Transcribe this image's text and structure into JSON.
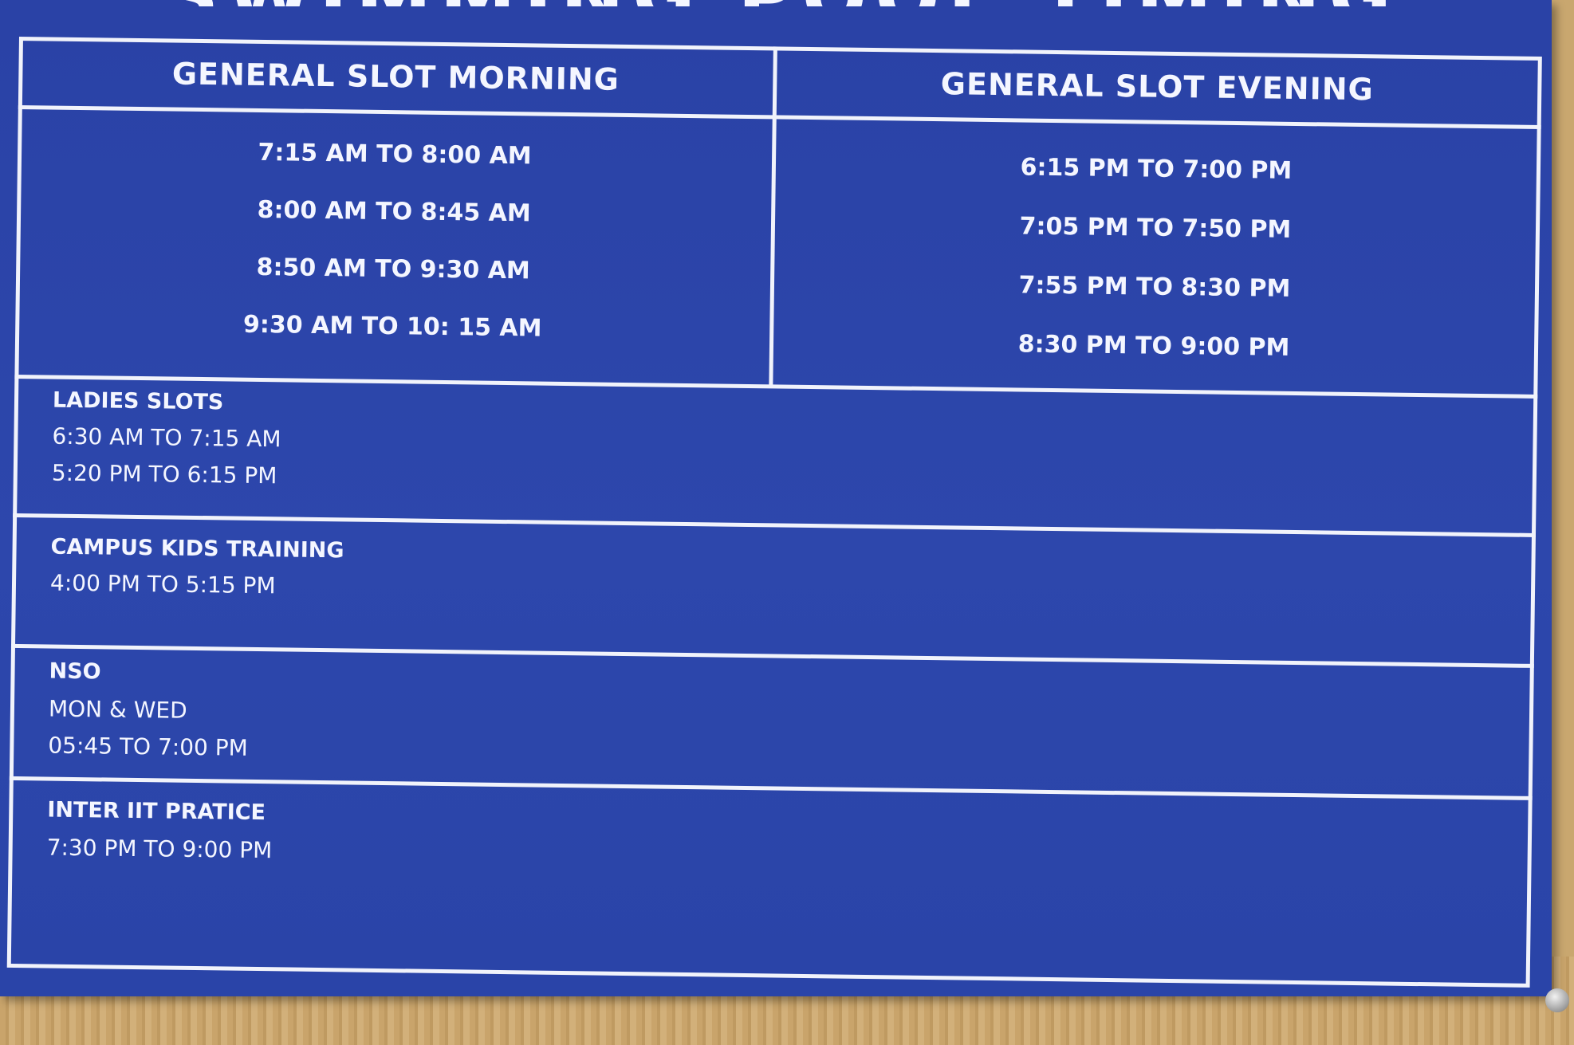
{
  "heading": "SWIMMING POOL TIMING",
  "general_morning": {
    "title": "GENERAL SLOT MORNING",
    "slots": [
      "7:15 AM TO 8:00 AM",
      "8:00 AM TO 8:45 AM",
      "8:50 AM TO 9:30 AM",
      "9:30 AM TO 10: 15 AM"
    ]
  },
  "general_evening": {
    "title": "GENERAL SLOT EVENING",
    "slots": [
      "6:15 PM TO 7:00 PM",
      "7:05 PM TO 7:50 PM",
      "7:55 PM TO 8:30 PM",
      "8:30 PM TO 9:00 PM"
    ]
  },
  "ladies": {
    "title": "LADIES SLOTS",
    "lines": [
      "6:30 AM TO 7:15 AM",
      "5:20 PM TO 6:15 PM"
    ]
  },
  "campus_kids": {
    "title": "CAMPUS KIDS TRAINING",
    "lines": [
      "4:00 PM TO 5:15 PM"
    ]
  },
  "nso": {
    "title": "NSO",
    "lines": [
      "MON & WED",
      "05:45 TO 7:00 PM"
    ]
  },
  "inter_iit": {
    "title": "INTER IIT PRATICE",
    "lines": [
      "7:30 PM TO 9:00 PM"
    ]
  },
  "colors": {
    "board": "#2d47ac",
    "text": "#f4f6ff",
    "wall": "#c9a76f"
  }
}
